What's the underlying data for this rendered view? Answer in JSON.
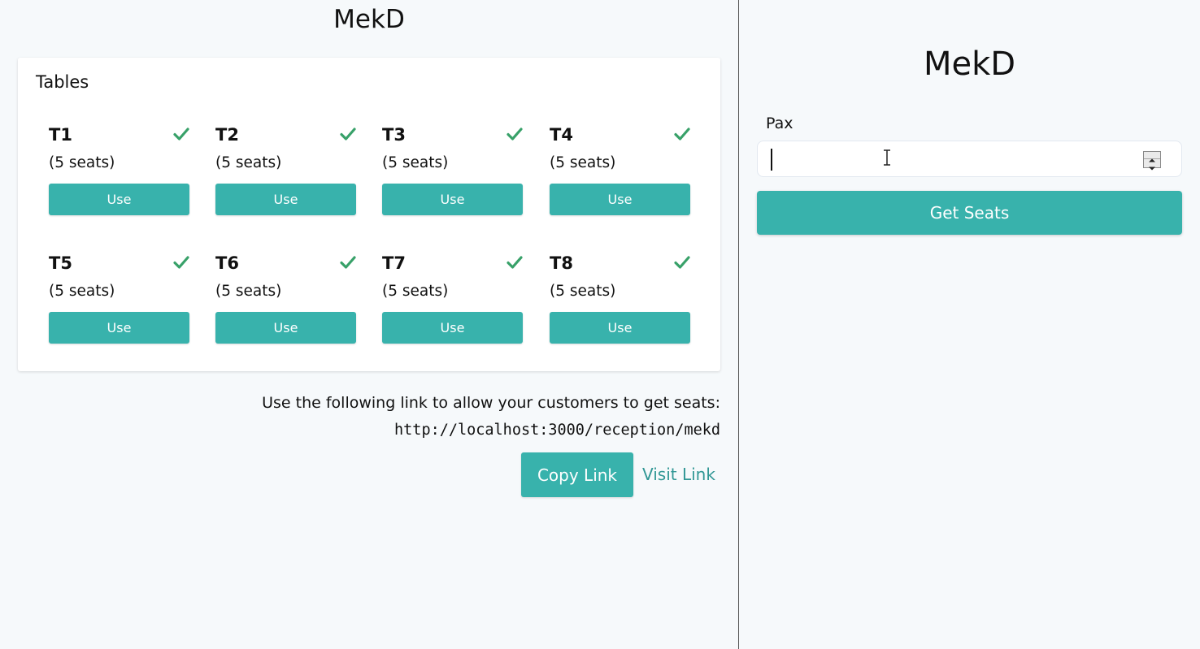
{
  "admin": {
    "title": "MekD",
    "tables_heading": "Tables",
    "tables": [
      {
        "name": "T1",
        "seats": "(5 seats)",
        "action": "Use",
        "status": "check-icon"
      },
      {
        "name": "T2",
        "seats": "(5 seats)",
        "action": "Use",
        "status": "check-icon"
      },
      {
        "name": "T3",
        "seats": "(5 seats)",
        "action": "Use",
        "status": "check-icon"
      },
      {
        "name": "T4",
        "seats": "(5 seats)",
        "action": "Use",
        "status": "check-icon"
      },
      {
        "name": "T5",
        "seats": "(5 seats)",
        "action": "Use",
        "status": "check-icon"
      },
      {
        "name": "T6",
        "seats": "(5 seats)",
        "action": "Use",
        "status": "check-icon"
      },
      {
        "name": "T7",
        "seats": "(5 seats)",
        "action": "Use",
        "status": "check-icon"
      },
      {
        "name": "T8",
        "seats": "(5 seats)",
        "action": "Use",
        "status": "check-icon"
      }
    ],
    "link_info": "Use the following link to allow your customers to get seats:",
    "link_url": "http://localhost:3000/reception/mekd",
    "copy_label": "Copy Link",
    "visit_label": "Visit Link"
  },
  "reception": {
    "title": "MekD",
    "pax_label": "Pax",
    "pax_value": "",
    "submit_label": "Get Seats"
  },
  "colors": {
    "accent": "#38b2ac",
    "check": "#38a169",
    "link": "#319795"
  }
}
